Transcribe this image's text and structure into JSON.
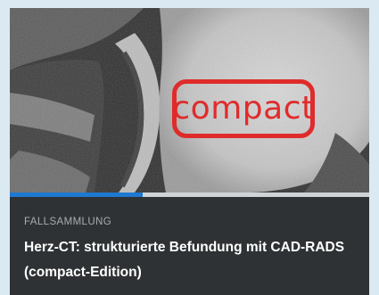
{
  "card": {
    "stamp_text": "compact",
    "category": "FALLSAMMLUNG",
    "title": "Herz-CT: strukturierte Befundung mit CAD-RADS (compact-Edition)",
    "progress_percent": 37
  },
  "colors": {
    "card_background": "#2f3234",
    "page_background": "#dbe9f2",
    "progress_fill": "#1f78d1",
    "progress_track": "#cfd3d6",
    "stamp_red": "#e02b2b"
  }
}
